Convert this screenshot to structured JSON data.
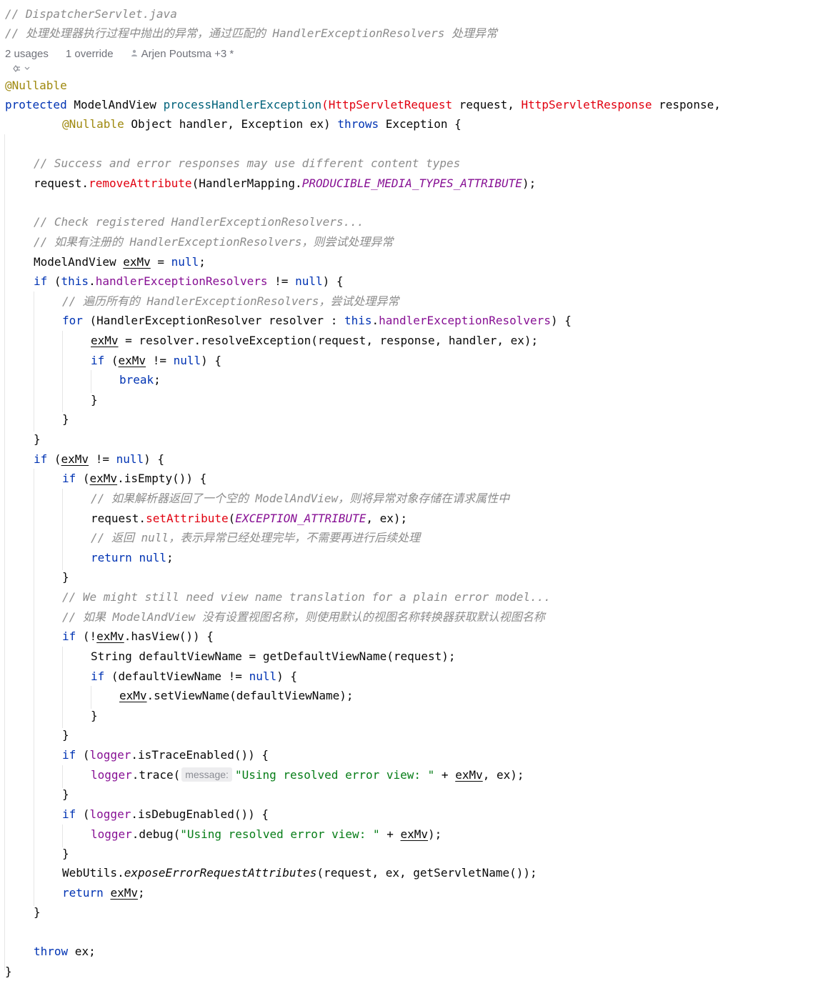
{
  "editor": {
    "file_comment": "// DispatcherServlet.java",
    "file_comment_cn": "// 处理处理器执行过程中抛出的异常，通过匹配的 HandlerExceptionResolvers 处理异常",
    "inlay": {
      "usages": "2 usages",
      "overrides": "1 override",
      "author_icon": "person-icon",
      "author": "Arjen Poutsma +3 *",
      "actions_icon": "gear-chevron-icon"
    },
    "param_hint": "message:",
    "lines": {
      "L4": "@Nullable",
      "L5a": "protected",
      "L5b": " ModelAndView ",
      "L5c": "processHandlerException",
      "L5d": "(",
      "L5e": "HttpServletRequest",
      "L5f": " request, ",
      "L5g": "HttpServletResponse",
      "L5h": " response,",
      "L6a": "@Nullable",
      "L6b": " Object handler, Exception ex) ",
      "L6c": "throws",
      "L6d": " Exception {",
      "L8": "// Success and error responses may use different content types",
      "L9a": "request.",
      "L9b": "removeAttribute",
      "L9c": "(HandlerMapping.",
      "L9d": "PRODUCIBLE_MEDIA_TYPES_ATTRIBUTE",
      "L9e": ");",
      "L11": "// Check registered HandlerExceptionResolvers...",
      "L12": "// 如果有注册的 HandlerExceptionResolvers，则尝试处理异常",
      "L13a": "ModelAndView ",
      "L13b": "exMv",
      "L13c": " = ",
      "L13d": "null",
      "L13e": ";",
      "L14a": "if",
      "L14b": " (",
      "L14c": "this",
      "L14d": ".",
      "L14e": "handlerExceptionResolvers",
      "L14f": " != ",
      "L14g": "null",
      "L14h": ") {",
      "L15": "// 遍历所有的 HandlerExceptionResolvers，尝试处理异常",
      "L16a": "for",
      "L16b": " (HandlerExceptionResolver resolver : ",
      "L16c": "this",
      "L16d": ".",
      "L16e": "handlerExceptionResolvers",
      "L16f": ") {",
      "L17a": "exMv",
      "L17b": " = resolver.resolveException(request, response, handler, ex);",
      "L18a": "if",
      "L18b": " (",
      "L18c": "exMv",
      "L18d": " != ",
      "L18e": "null",
      "L18f": ") {",
      "L19a": "break",
      "L19b": ";",
      "L20": "}",
      "L21": "}",
      "L22": "}",
      "L23a": "if",
      "L23b": " (",
      "L23c": "exMv",
      "L23d": " != ",
      "L23e": "null",
      "L23f": ") {",
      "L24a": "if",
      "L24b": " (",
      "L24c": "exMv",
      "L24d": ".isEmpty()) {",
      "L25": "// 如果解析器返回了一个空的 ModelAndView，则将异常对象存储在请求属性中",
      "L26a": "request.",
      "L26b": "setAttribute",
      "L26c": "(",
      "L26d": "EXCEPTION_ATTRIBUTE",
      "L26e": ", ex);",
      "L27": "// 返回 null，表示异常已经处理完毕，不需要再进行后续处理",
      "L28a": "return",
      "L28b": " ",
      "L28c": "null",
      "L28d": ";",
      "L29": "}",
      "L30": "// We might still need view name translation for a plain error model...",
      "L31": "// 如果 ModelAndView 没有设置视图名称，则使用默认的视图名称转换器获取默认视图名称",
      "L32a": "if",
      "L32b": " (!",
      "L32c": "exMv",
      "L32d": ".hasView()) {",
      "L33": "String defaultViewName = getDefaultViewName(request);",
      "L34a": "if",
      "L34b": " (defaultViewName != ",
      "L34c": "null",
      "L34d": ") {",
      "L35a": "exMv",
      "L35b": ".setViewName(defaultViewName);",
      "L36": "}",
      "L37": "}",
      "L38a": "if",
      "L38b": " (",
      "L38c": "logger",
      "L38d": ".isTraceEnabled()) {",
      "L39a": "logger",
      "L39b": ".trace(",
      "L39c": "\"Using resolved error view: \"",
      "L39d": " + ",
      "L39e": "exMv",
      "L39f": ", ex);",
      "L40": "}",
      "L41a": "if",
      "L41b": " (",
      "L41c": "logger",
      "L41d": ".isDebugEnabled()) {",
      "L42a": "logger",
      "L42b": ".debug(",
      "L42c": "\"Using resolved error view: \"",
      "L42d": " + ",
      "L42e": "exMv",
      "L42f": ");",
      "L43": "}",
      "L44a": "WebUtils.",
      "L44b": "exposeErrorRequestAttributes",
      "L44c": "(request, ex, getServletName());",
      "L45a": "return",
      "L45b": " ",
      "L45c": "exMv",
      "L45d": ";",
      "L46": "}",
      "L48a": "throw",
      "L48b": " ex;",
      "L49": "}"
    },
    "colors": {
      "comment": "#8c8c8c",
      "keyword": "#0033b3",
      "annotation": "#9e880d",
      "method_declaration": "#00627a",
      "string": "#067d17",
      "field": "#871094",
      "highlight_red": "#e1000f",
      "background": "#ffffff"
    }
  }
}
